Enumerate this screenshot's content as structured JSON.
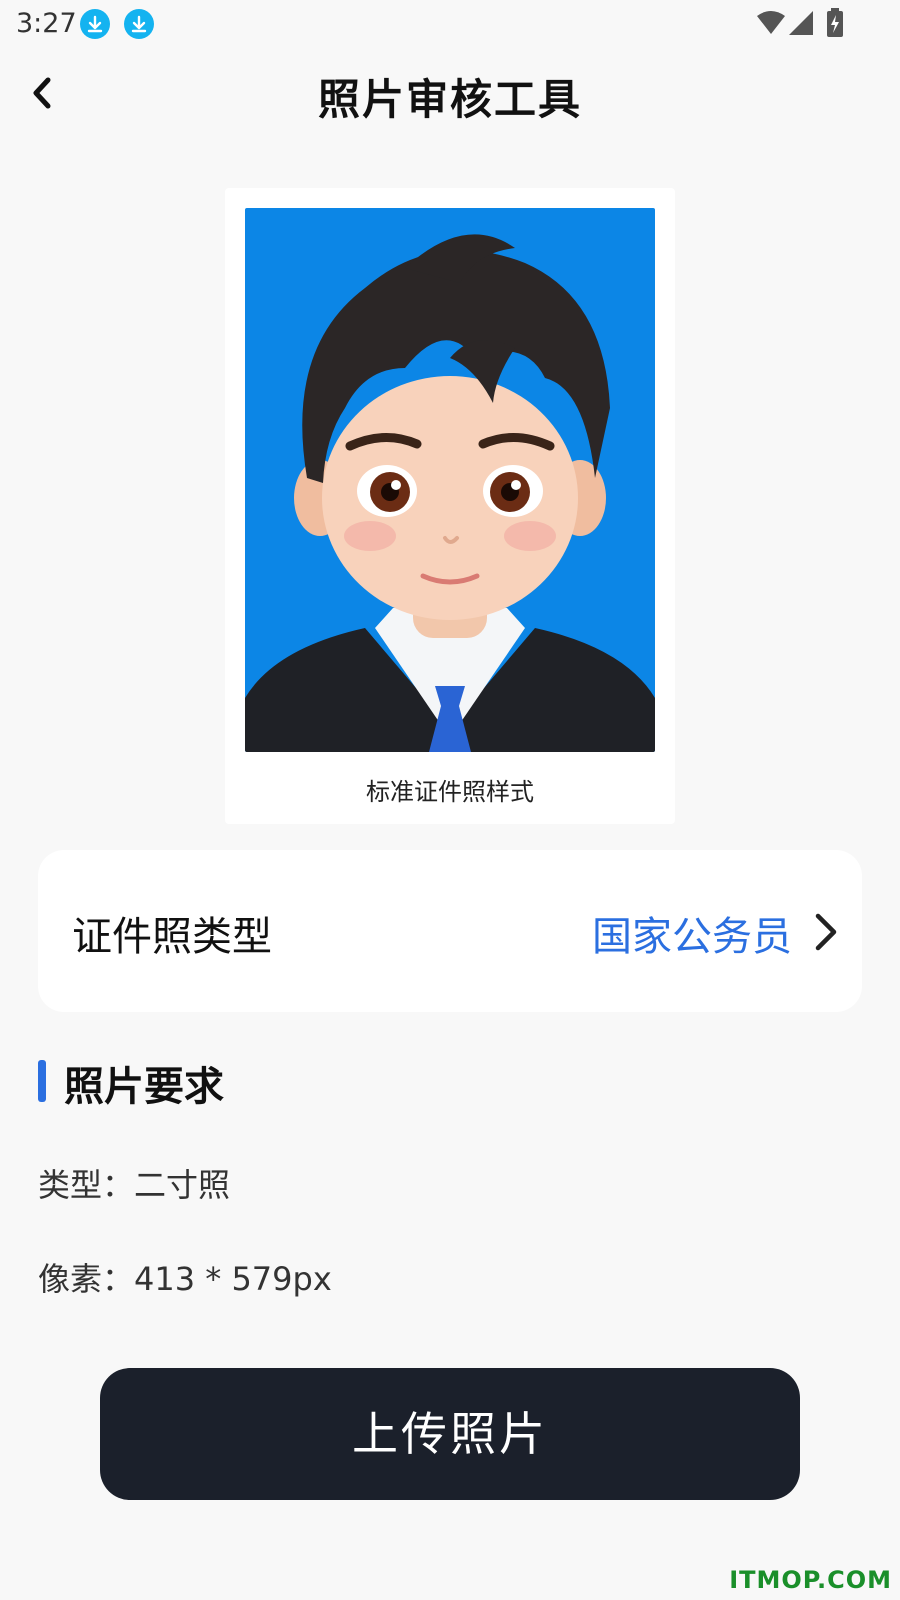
{
  "status_bar": {
    "time": "3:27"
  },
  "header": {
    "title": "照片审核工具"
  },
  "sample": {
    "caption": "标准证件照样式"
  },
  "type_selector": {
    "label": "证件照类型",
    "value": "国家公务员"
  },
  "requirements": {
    "title": "照片要求",
    "type_label": "类型：",
    "type_value": "二寸照",
    "pixel_label": "像素：",
    "pixel_value": "413 * 579px"
  },
  "upload_button": {
    "label": "上传照片"
  },
  "watermark": "ITMOP.COM",
  "colors": {
    "accent": "#2b6fe0",
    "photo_background": "#0c86e6",
    "button_background": "#1b202b",
    "download_badge": "#14b3f0"
  }
}
